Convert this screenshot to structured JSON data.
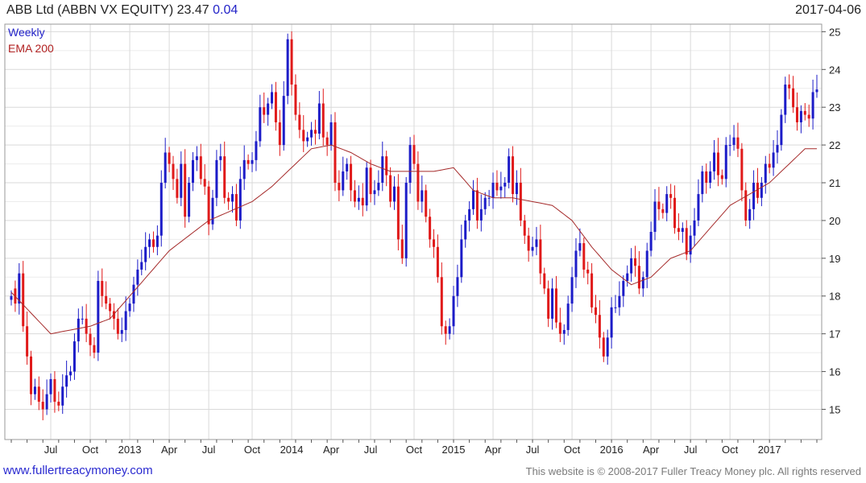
{
  "header": {
    "title": "ABB Ltd (ABBN VX EQUITY) 23.47",
    "change": "0.04",
    "date": "2017-04-06"
  },
  "footer": {
    "site": "www.fullertreacymoney.com",
    "copyright": "This website is © 2008-2017 Fuller Treacy Money plc. All rights reserved"
  },
  "colors": {
    "up": "#1c1cc8",
    "down": "#e01a1a",
    "ema": "#a52a2a",
    "grid": "#d9d9d9",
    "frame": "#9a9a9a"
  },
  "chart_data": {
    "type": "candlestick",
    "legend": [
      "Weekly",
      "EMA 200"
    ],
    "ylim": [
      14.2,
      25.2
    ],
    "yticks": [
      15,
      16,
      17,
      18,
      19,
      20,
      21,
      22,
      23,
      24,
      25
    ],
    "grid": true,
    "legend_position": "top-left",
    "xtick_labels": [
      "Jul",
      "Oct",
      "2013",
      "Apr",
      "Jul",
      "Oct",
      "2014",
      "Apr",
      "Jul",
      "Oct",
      "2015",
      "Apr",
      "Jul",
      "Oct",
      "2016",
      "Apr",
      "Jul",
      "Oct",
      "2017"
    ],
    "xtick_index": [
      10,
      20,
      30,
      40,
      50,
      61,
      71,
      81,
      91,
      102,
      112,
      122,
      132,
      142,
      152,
      162,
      172,
      182,
      192
    ],
    "series": [
      {
        "name": "Weekly",
        "close": [
          18.0,
          17.8,
          18.6,
          17.2,
          16.4,
          15.4,
          15.6,
          15.2,
          15.0,
          15.4,
          15.8,
          15.2,
          15.1,
          15.6,
          15.9,
          16.0,
          16.8,
          17.4,
          17.4,
          17.0,
          16.7,
          16.5,
          18.4,
          18.0,
          17.8,
          17.6,
          17.4,
          17.0,
          17.1,
          17.6,
          17.8,
          18.3,
          18.7,
          18.9,
          19.3,
          19.5,
          19.3,
          19.6,
          21.0,
          21.8,
          21.5,
          21.1,
          20.6,
          21.5,
          20.1,
          21.0,
          21.6,
          21.7,
          21.1,
          20.9,
          19.9,
          20.6,
          21.6,
          21.7,
          20.6,
          20.5,
          20.7,
          20.0,
          21.1,
          21.6,
          21.5,
          21.6,
          22.1,
          23.0,
          22.8,
          23.1,
          23.4,
          22.6,
          22.0,
          23.3,
          24.8,
          23.6,
          22.8,
          22.4,
          22.1,
          22.2,
          22.4,
          22.3,
          23.1,
          22.2,
          22.0,
          22.6,
          21.0,
          20.8,
          21.3,
          21.5,
          20.8,
          20.5,
          20.6,
          20.4,
          21.4,
          20.7,
          20.8,
          21.0,
          21.7,
          21.2,
          20.5,
          20.9,
          19.5,
          19.0,
          21.0,
          22.0,
          21.5,
          20.5,
          20.8,
          20.1,
          19.5,
          19.3,
          18.5,
          17.2,
          17.0,
          17.2,
          18.0,
          18.5,
          19.5,
          20.0,
          20.3,
          20.8,
          20.0,
          20.3,
          20.6,
          20.6,
          21.0,
          20.8,
          20.9,
          21.0,
          21.7,
          20.7,
          21.0,
          20.0,
          19.6,
          19.2,
          19.3,
          19.5,
          18.6,
          18.2,
          17.4,
          18.2,
          17.3,
          17.0,
          17.1,
          17.8,
          18.5,
          19.2,
          19.4,
          18.7,
          18.6,
          17.7,
          17.5,
          16.9,
          16.4,
          16.9,
          17.7,
          17.7,
          18.0,
          18.4,
          18.6,
          19.0,
          18.8,
          18.2,
          18.5,
          19.2,
          19.7,
          20.5,
          20.3,
          20.2,
          20.7,
          20.6,
          19.8,
          19.7,
          19.8,
          19.1,
          19.6,
          20.0,
          20.7,
          21.3,
          21.0,
          21.3,
          21.8,
          21.2,
          21.1,
          22.0,
          22.0,
          22.2,
          21.9,
          20.8,
          20.0,
          20.3,
          21.0,
          20.6,
          21.0,
          21.5,
          21.4,
          21.8,
          22.0,
          22.8,
          23.6,
          23.5,
          23.0,
          22.6,
          22.9,
          22.8,
          22.7,
          23.4,
          23.47
        ],
        "open": [
          17.9,
          18.2,
          17.8,
          18.6,
          17.2,
          16.4,
          15.4,
          15.6,
          15.2,
          15.0,
          15.4,
          15.8,
          15.2,
          15.1,
          15.6,
          15.9,
          16.0,
          16.8,
          17.4,
          17.4,
          17.0,
          16.7,
          16.5,
          18.4,
          18.0,
          17.8,
          17.6,
          17.4,
          17.0,
          17.1,
          17.6,
          17.8,
          18.3,
          18.7,
          18.9,
          19.3,
          19.5,
          19.3,
          19.6,
          21.0,
          21.8,
          21.5,
          21.1,
          20.6,
          21.5,
          20.1,
          21.0,
          21.6,
          21.7,
          21.1,
          20.9,
          19.9,
          20.6,
          21.6,
          21.7,
          20.6,
          20.5,
          20.7,
          20.0,
          21.1,
          21.6,
          21.5,
          21.6,
          22.1,
          23.0,
          22.8,
          23.1,
          23.4,
          22.6,
          22.0,
          23.3,
          24.8,
          23.6,
          22.8,
          22.4,
          22.1,
          22.2,
          22.4,
          22.3,
          23.1,
          22.2,
          22.0,
          22.6,
          21.0,
          20.8,
          21.3,
          21.5,
          20.8,
          20.5,
          20.6,
          20.4,
          21.4,
          20.7,
          20.8,
          21.0,
          21.7,
          21.2,
          20.5,
          20.9,
          19.5,
          19.0,
          21.0,
          22.0,
          21.5,
          20.5,
          20.8,
          20.1,
          19.5,
          19.3,
          18.5,
          17.2,
          17.0,
          17.2,
          18.0,
          18.5,
          19.5,
          20.0,
          20.3,
          20.8,
          20.0,
          20.3,
          20.6,
          20.6,
          21.0,
          20.8,
          20.9,
          21.0,
          21.7,
          20.7,
          21.0,
          20.0,
          19.6,
          19.2,
          19.3,
          19.5,
          18.6,
          18.2,
          17.4,
          18.2,
          17.3,
          17.0,
          17.1,
          17.8,
          18.5,
          19.2,
          19.4,
          18.7,
          18.6,
          17.7,
          17.5,
          16.9,
          16.4,
          16.9,
          17.7,
          17.7,
          18.0,
          18.4,
          18.6,
          19.0,
          18.8,
          18.2,
          18.5,
          19.2,
          19.7,
          20.5,
          20.3,
          20.2,
          20.7,
          20.6,
          19.8,
          19.7,
          19.8,
          19.1,
          19.6,
          20.0,
          20.7,
          21.3,
          21.0,
          21.3,
          21.8,
          21.2,
          21.1,
          22.0,
          22.0,
          22.2,
          21.9,
          20.8,
          20.0,
          20.3,
          21.0,
          20.6,
          21.0,
          21.5,
          21.4,
          21.8,
          22.0,
          22.8,
          23.6,
          23.5,
          23.0,
          22.6,
          22.9,
          22.8,
          22.7,
          23.4
        ]
      },
      {
        "name": "EMA 200",
        "values_keypoints_index": [
          0,
          10,
          20,
          25,
          30,
          40,
          50,
          61,
          66,
          71,
          76,
          81,
          86,
          91,
          96,
          102,
          107,
          112,
          117,
          122,
          127,
          132,
          137,
          142,
          147,
          152,
          157,
          162,
          167,
          172,
          177,
          182,
          187,
          192,
          198,
          201
        ],
        "values_keypoints": [
          18.1,
          17.0,
          17.2,
          17.4,
          18.0,
          19.2,
          20.0,
          20.5,
          20.9,
          21.4,
          21.9,
          22.0,
          21.8,
          21.5,
          21.3,
          21.3,
          21.3,
          21.4,
          20.8,
          20.6,
          20.6,
          20.5,
          20.4,
          20.0,
          19.3,
          18.7,
          18.3,
          18.5,
          19.0,
          19.2,
          19.8,
          20.4,
          20.7,
          21.0,
          21.6,
          21.9
        ]
      }
    ]
  }
}
